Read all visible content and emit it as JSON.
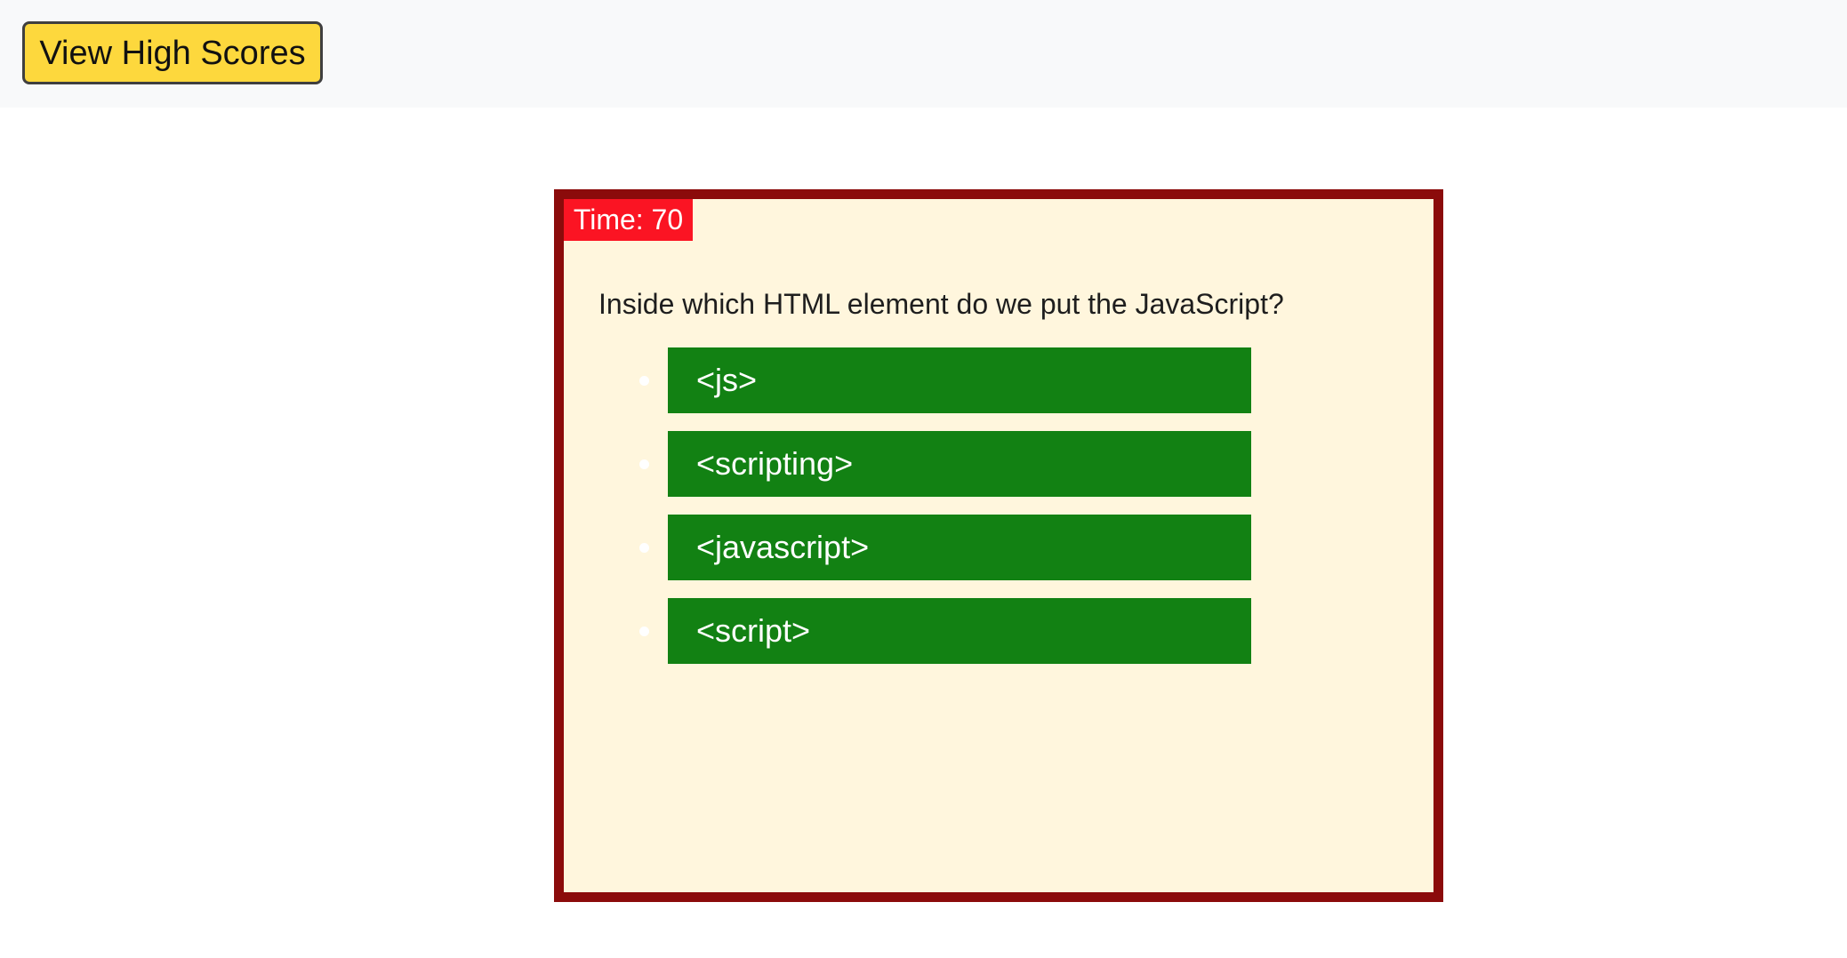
{
  "header": {
    "high_scores_label": "View High Scores"
  },
  "quiz": {
    "timer_label": "Time: 70",
    "question": "Inside which HTML element do we put the JavaScript?",
    "answers": [
      {
        "label": "<js>"
      },
      {
        "label": "<scripting>"
      },
      {
        "label": "<javascript>"
      },
      {
        "label": "<script>"
      }
    ]
  },
  "colors": {
    "topbar_bg": "#f8f9fa",
    "high_scores_bg": "#fdd83d",
    "quiz_border": "#8b0b0b",
    "quiz_bg": "#fff6dd",
    "timer_bg": "#fb1423",
    "answer_bg": "#128113"
  }
}
